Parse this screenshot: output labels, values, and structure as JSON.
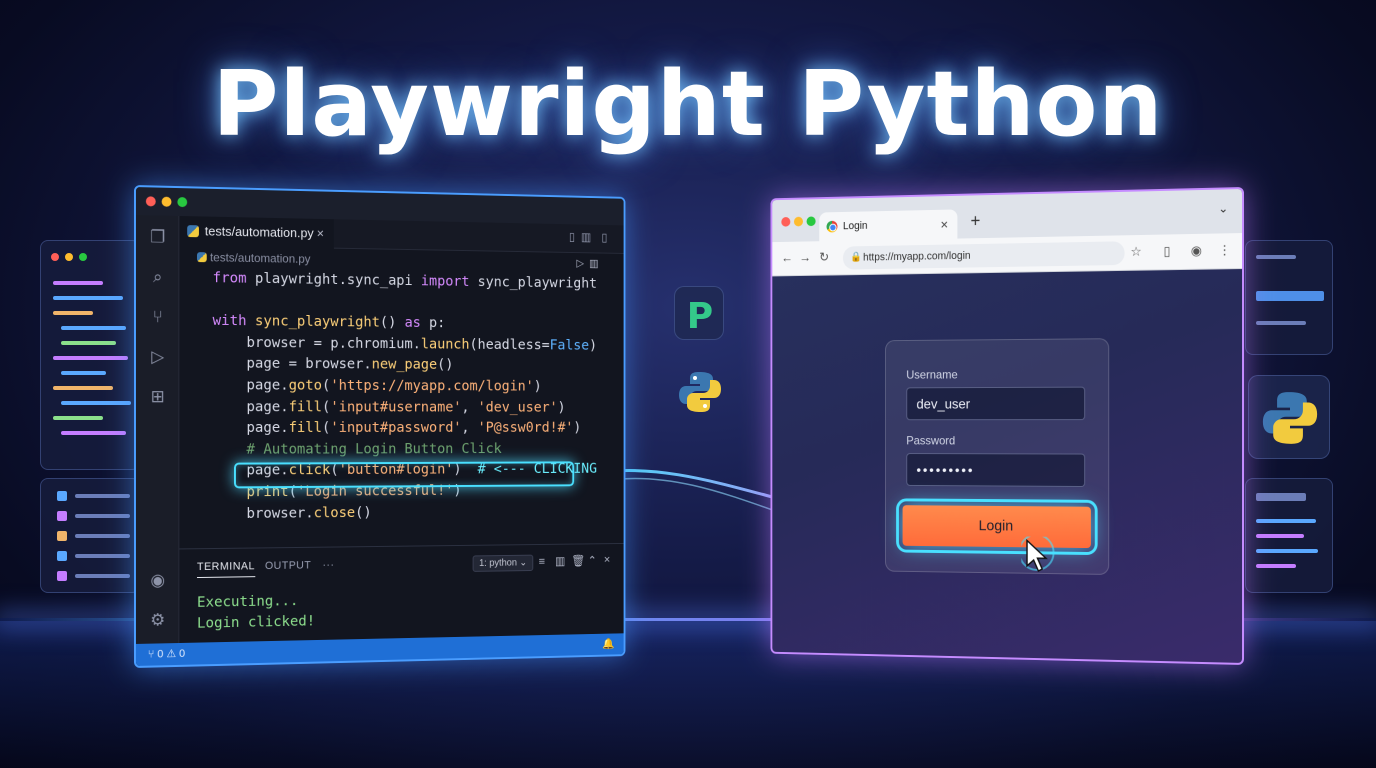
{
  "title": "Playwright Python",
  "editor": {
    "tab_label": "tests/automation.py",
    "tab_close": "×",
    "breadcrumb": "tests/automation.py",
    "code_lines": [
      [
        {
          "t": "from ",
          "c": "kw"
        },
        {
          "t": "playwright.sync_api ",
          "c": ""
        },
        {
          "t": "import ",
          "c": "kw"
        },
        {
          "t": "sync_playwright",
          "c": ""
        }
      ],
      [],
      [
        {
          "t": "with ",
          "c": "kw"
        },
        {
          "t": "sync_playwright",
          "c": "fn"
        },
        {
          "t": "() ",
          "c": ""
        },
        {
          "t": "as ",
          "c": "kw"
        },
        {
          "t": "p:",
          "c": ""
        }
      ],
      [
        {
          "t": "    browser = p.chromium.",
          "c": ""
        },
        {
          "t": "launch",
          "c": "fn"
        },
        {
          "t": "(headless=",
          "c": ""
        },
        {
          "t": "False",
          "c": "bool"
        },
        {
          "t": ")",
          "c": ""
        }
      ],
      [
        {
          "t": "    page = browser.",
          "c": ""
        },
        {
          "t": "new_page",
          "c": "fn"
        },
        {
          "t": "()",
          "c": ""
        }
      ],
      [
        {
          "t": "    page.",
          "c": ""
        },
        {
          "t": "goto",
          "c": "fn"
        },
        {
          "t": "(",
          "c": ""
        },
        {
          "t": "'https://myapp.com/login'",
          "c": "str"
        },
        {
          "t": ")",
          "c": ""
        }
      ],
      [
        {
          "t": "    page.",
          "c": ""
        },
        {
          "t": "fill",
          "c": "fn"
        },
        {
          "t": "(",
          "c": ""
        },
        {
          "t": "'input#username'",
          "c": "str"
        },
        {
          "t": ", ",
          "c": ""
        },
        {
          "t": "'dev_user'",
          "c": "str"
        },
        {
          "t": ")",
          "c": ""
        }
      ],
      [
        {
          "t": "    page.",
          "c": ""
        },
        {
          "t": "fill",
          "c": "fn"
        },
        {
          "t": "(",
          "c": ""
        },
        {
          "t": "'input#password'",
          "c": "str"
        },
        {
          "t": ", ",
          "c": ""
        },
        {
          "t": "'P@ssw0rd!#'",
          "c": "str"
        },
        {
          "t": ")",
          "c": ""
        }
      ],
      [
        {
          "t": "    # Automating Login Button Click",
          "c": "cm"
        }
      ],
      [
        {
          "t": "    page.",
          "c": ""
        },
        {
          "t": "click",
          "c": "fn"
        },
        {
          "t": "(",
          "c": ""
        },
        {
          "t": "'button#login'",
          "c": "str"
        },
        {
          "t": ")  ",
          "c": ""
        },
        {
          "t": "# <--- CLICKING",
          "c": "hl-comment"
        }
      ],
      [
        {
          "t": "    print",
          "c": "fn"
        },
        {
          "t": "(",
          "c": ""
        },
        {
          "t": "'Login successful!'",
          "c": "str"
        },
        {
          "t": ")",
          "c": ""
        }
      ],
      [
        {
          "t": "    browser.",
          "c": ""
        },
        {
          "t": "close",
          "c": "fn"
        },
        {
          "t": "()",
          "c": ""
        }
      ]
    ],
    "terminal_tab": "TERMINAL",
    "output_tab": "OUTPUT",
    "more": "···",
    "terminal_select": "1: python",
    "terminal_lines": [
      "Executing...",
      "Login clicked!"
    ],
    "status_text": "⑂ 0 ⚠ 0"
  },
  "browser": {
    "tab_title": "Login",
    "tab_close": "×",
    "new_tab": "+",
    "url": "https://myapp.com/login",
    "username_label": "Username",
    "username_value": "dev_user",
    "password_label": "Password",
    "password_value": "•••••••••",
    "login_button": "Login"
  },
  "colors": {
    "editor_border": "#4a9dff",
    "browser_border": "#c58cff",
    "highlight": "#49e0ff",
    "login_button": "#ff7a44"
  }
}
